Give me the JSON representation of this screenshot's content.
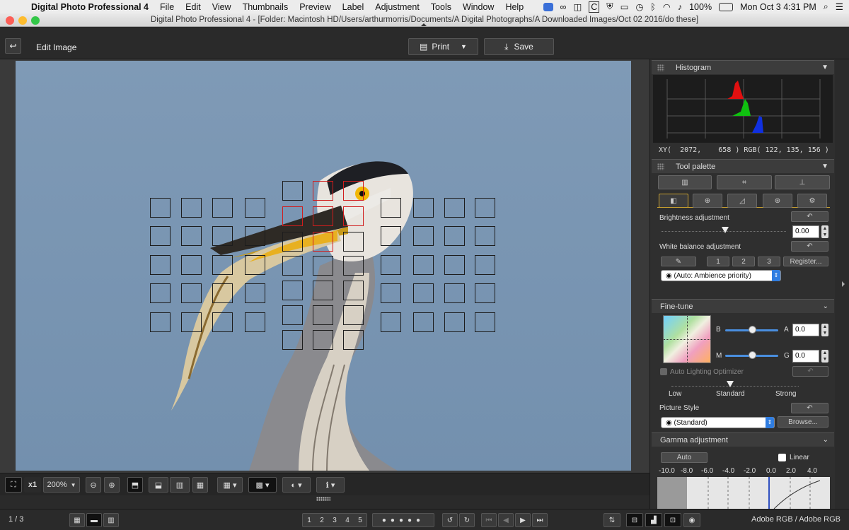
{
  "menubar": {
    "app_name": "Digital Photo Professional 4",
    "items": [
      "File",
      "Edit",
      "View",
      "Thumbnails",
      "Preview",
      "Label",
      "Adjustment",
      "Tools",
      "Window",
      "Help"
    ],
    "battery": "100%",
    "clock": "Mon Oct 3  4:31 PM",
    "tray_letter_c": "C"
  },
  "window": {
    "title": "Digital Photo Professional 4 - [Folder: Macintosh HD/Users/arthurmorris/Documents/A Digital Photographs/A Downloaded Images/Oct 02 2016/do these]"
  },
  "toolbar": {
    "mode_label": "Edit Image",
    "print_label": "Print",
    "save_label": "Save"
  },
  "histogram": {
    "title": "Histogram",
    "readout": "XY(  2072,    658 ) RGB( 122, 135, 156 )",
    "colors": {
      "red": "#e01010",
      "green": "#10c010",
      "blue": "#1030e0"
    }
  },
  "tool_palette": {
    "title": "Tool palette",
    "brightness_label": "Brightness adjustment",
    "brightness_value": "0.00",
    "white_balance_label": "White balance adjustment",
    "wb_presets": [
      "1",
      "2",
      "3"
    ],
    "register_label": "Register...",
    "wb_mode": "(Auto: Ambience priority)"
  },
  "fine_tune": {
    "title": "Fine-tune",
    "b_label": "B",
    "a_label": "A",
    "a_value": "0.0",
    "m_label": "M",
    "g_label": "G",
    "g_value": "0.0",
    "alo_label": "Auto Lighting Optimizer",
    "alo_levels": [
      "Low",
      "Standard",
      "Strong"
    ],
    "picture_style_label": "Picture Style",
    "picture_style_value": "(Standard)",
    "browse_label": "Browse..."
  },
  "gamma": {
    "title": "Gamma adjustment",
    "auto_label": "Auto",
    "linear_label": "Linear",
    "scale": [
      "-10.0",
      "-8.0",
      "-6.0",
      "-4.0",
      "-2.0",
      "0.0",
      "2.0",
      "4.0"
    ]
  },
  "viewbar": {
    "zoom_x1": "x1",
    "zoom_level": "200%"
  },
  "statusbar": {
    "page_counter": "1 / 3",
    "ratings": [
      "1",
      "2",
      "3",
      "4",
      "5"
    ],
    "color_space": "Adobe RGB / Adobe RGB"
  }
}
